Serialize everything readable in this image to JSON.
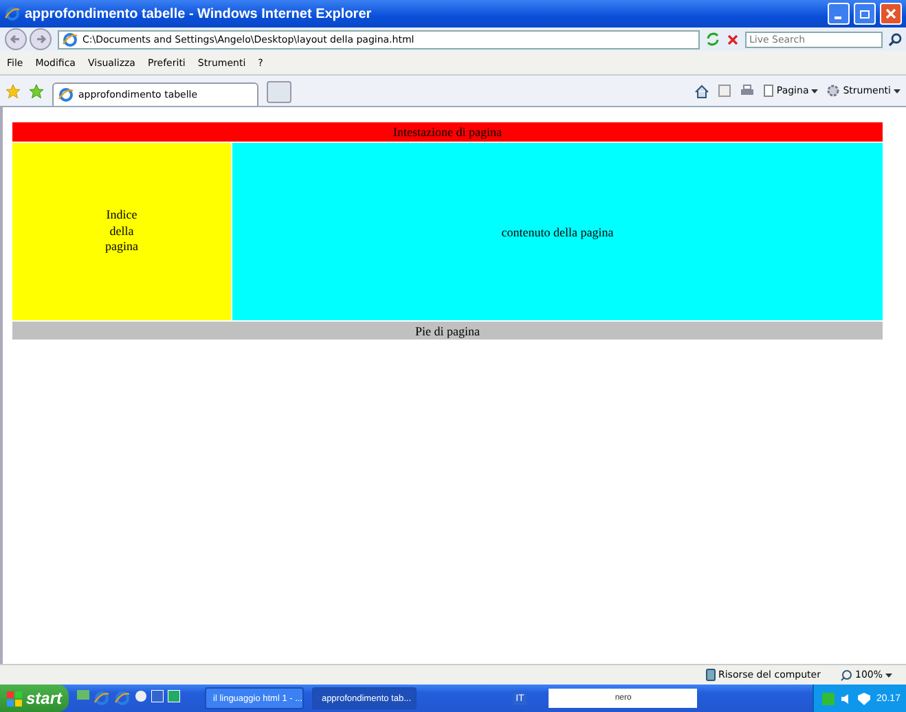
{
  "window": {
    "title": "approfondimento tabelle - Windows Internet Explorer"
  },
  "address": {
    "value": "C:\\Documents and Settings\\Angelo\\Desktop\\layout della pagina.html"
  },
  "search": {
    "placeholder": "Live Search"
  },
  "menu": [
    "File",
    "Modifica",
    "Visualizza",
    "Preferiti",
    "Strumenti",
    "?"
  ],
  "tabs": [
    {
      "label": "approfondimento tabelle",
      "selected": true
    }
  ],
  "commands": [
    "Pagina",
    "Strumenti"
  ],
  "page": {
    "header": "Intestazione di pagina",
    "sidebar": "Indice della pagina",
    "content": "contenuto della pagina",
    "footer": "Pie di pagina"
  },
  "status_bar": {
    "zone": "Risorse del computer",
    "zoom": "100%"
  },
  "taskbar": {
    "start": "start",
    "tasks": [
      {
        "label": "il linguaggio html 1 - ...",
        "selected": false
      },
      {
        "label": "approfondimento tab...",
        "selected": true
      }
    ],
    "language": "IT",
    "toolbar": "nero",
    "clock": "20.17"
  }
}
